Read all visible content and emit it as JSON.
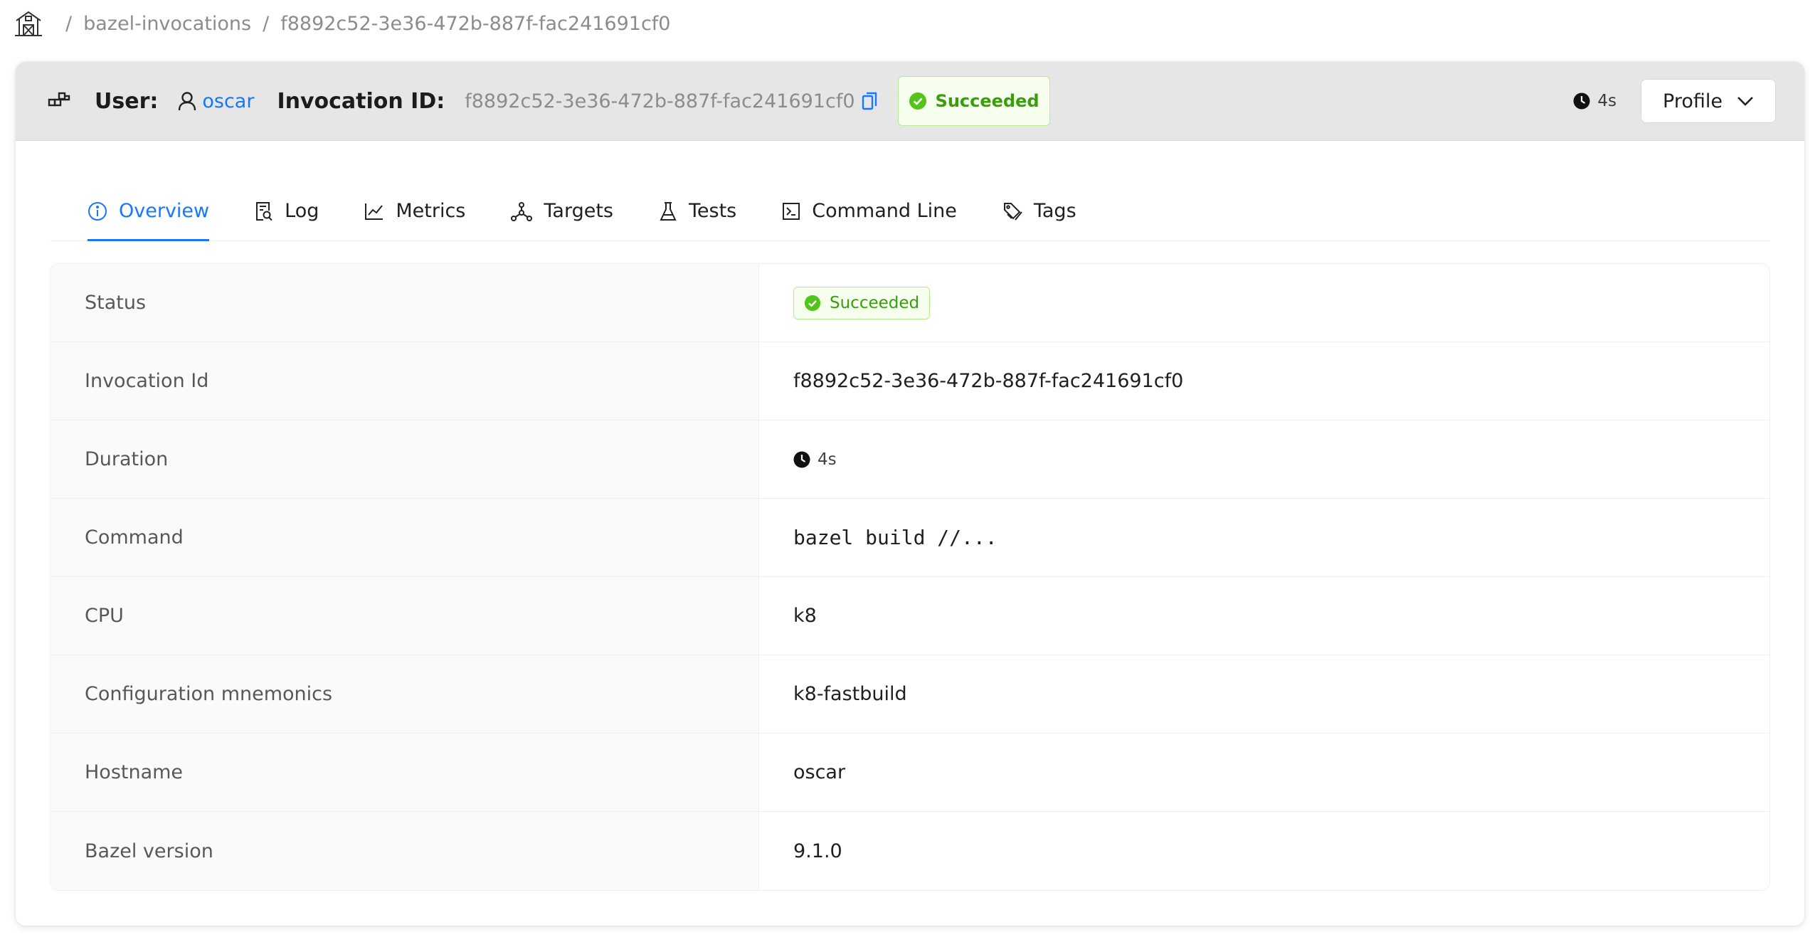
{
  "breadcrumb": {
    "home_icon": "barn-home-icon",
    "link": "bazel-invocations",
    "current": "f8892c52-3e36-472b-887f-fac241691cf0"
  },
  "header": {
    "grid_icon": "blocks-icon",
    "user_label": "User:",
    "user_name": "oscar",
    "invocation_label": "Invocation ID:",
    "invocation_id": "f8892c52-3e36-472b-887f-fac241691cf0",
    "status": "Succeeded",
    "duration": "4s",
    "profile_label": "Profile"
  },
  "tabs": [
    {
      "label": "Overview",
      "icon": "info-circle-icon",
      "active": true
    },
    {
      "label": "Log",
      "icon": "file-search-icon"
    },
    {
      "label": "Metrics",
      "icon": "line-chart-icon"
    },
    {
      "label": "Targets",
      "icon": "deployment-unit-icon"
    },
    {
      "label": "Tests",
      "icon": "experiment-icon"
    },
    {
      "label": "Command Line",
      "icon": "code-icon"
    },
    {
      "label": "Tags",
      "icon": "tags-icon"
    }
  ],
  "details": {
    "status_label": "Status",
    "status_value": "Succeeded",
    "invocation_label": "Invocation Id",
    "invocation_value": "f8892c52-3e36-472b-887f-fac241691cf0",
    "duration_label": "Duration",
    "duration_value": "4s",
    "command_label": "Command",
    "command_value": "bazel build //...",
    "cpu_label": "CPU",
    "cpu_value": "k8",
    "config_label": "Configuration mnemonics",
    "config_value": "k8-fastbuild",
    "hostname_label": "Hostname",
    "hostname_value": "oscar",
    "bazel_label": "Bazel version",
    "bazel_value": "9.1.0"
  },
  "colors": {
    "accent": "#1677ff",
    "success_bg": "#f6ffed",
    "success_border": "#b7eb8f",
    "success_text": "#389e0d",
    "header_bg": "#e6e6e6"
  }
}
